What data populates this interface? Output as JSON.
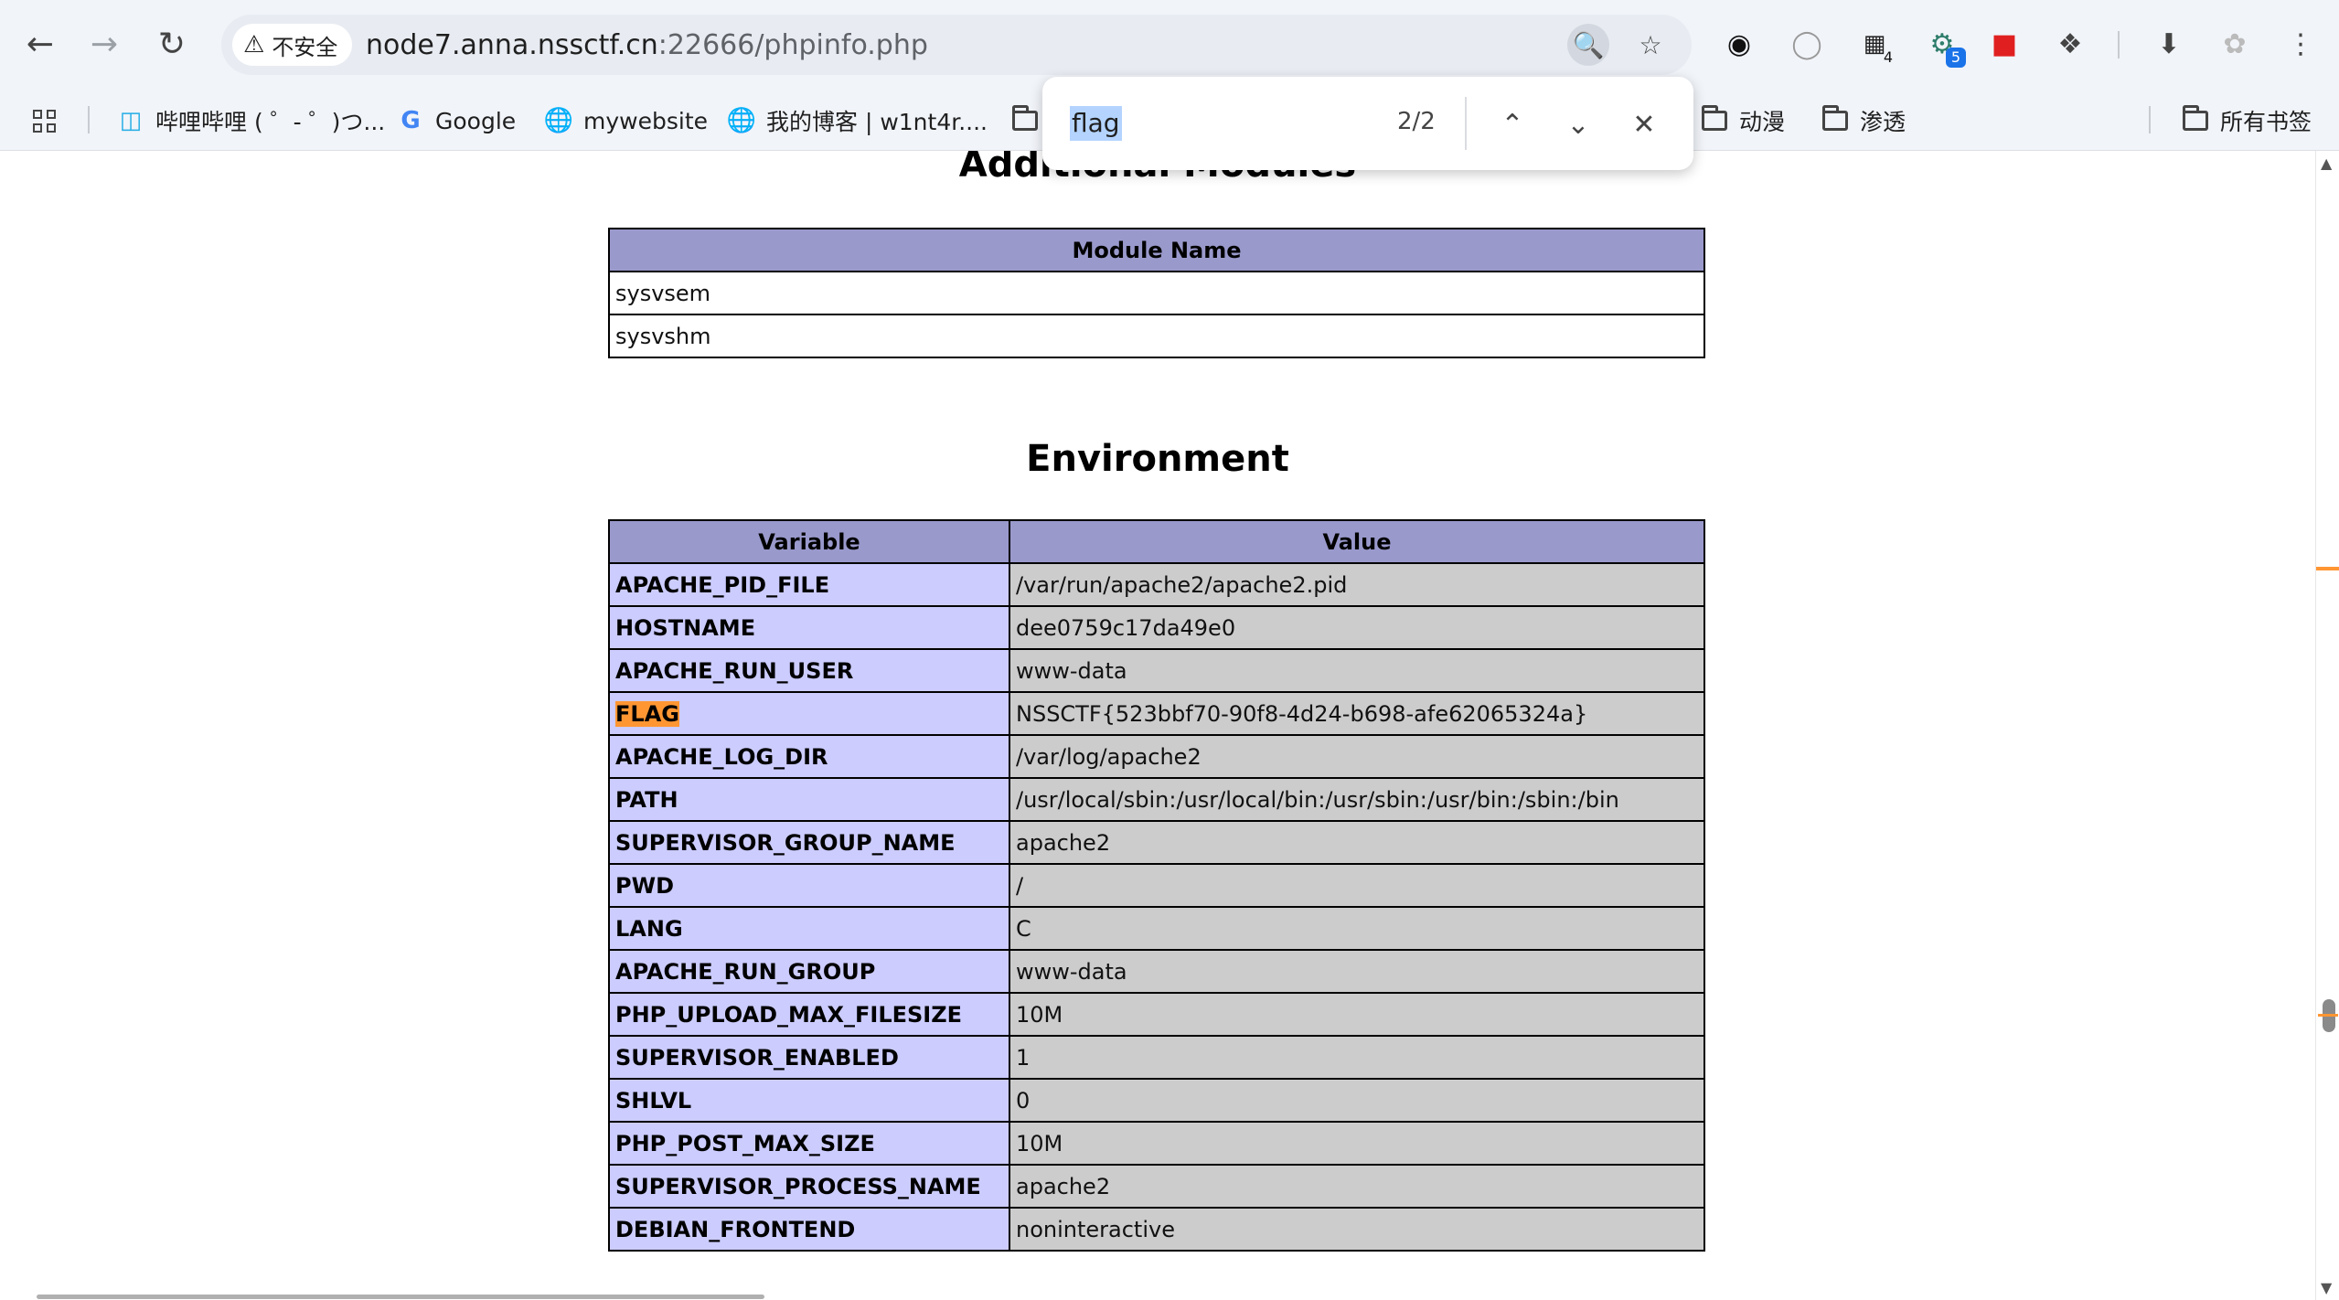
{
  "browser": {
    "security_label": "不安全",
    "url_host": "node7.anna.nssctf.cn",
    "url_rest": ":22666/phpinfo.php",
    "extension_badges": {
      "ext3": "4",
      "ext4": "5"
    }
  },
  "bookmarks": {
    "items": [
      {
        "label": "哔哩哔哩 ( ゜- ゜)つ...",
        "icon": "bilibili-icon"
      },
      {
        "label": "Google",
        "icon": "google-icon"
      },
      {
        "label": "mywebsite",
        "icon": "globe-icon"
      },
      {
        "label": "我的博客 | w1nt4r....",
        "icon": "globe-icon"
      },
      {
        "label": "动漫",
        "icon": "folder-icon"
      },
      {
        "label": "渗透",
        "icon": "folder-icon"
      }
    ],
    "all_bookmarks_label": "所有书签"
  },
  "find_bar": {
    "query": "flag",
    "count": "2/2"
  },
  "page": {
    "modules_heading": "Additional Modules",
    "modules_column": "Module Name",
    "modules": [
      "sysvsem",
      "sysvshm"
    ],
    "environment_heading": "Environment",
    "env_columns": {
      "variable": "Variable",
      "value": "Value"
    },
    "env_rows": [
      {
        "variable": "APACHE_PID_FILE",
        "value": "/var/run/apache2/apache2.pid"
      },
      {
        "variable": "HOSTNAME",
        "value": "dee0759c17da49e0"
      },
      {
        "variable": "APACHE_RUN_USER",
        "value": "www-data"
      },
      {
        "variable": "FLAG",
        "value": "NSSCTF{523bbf70-90f8-4d24-b698-afe62065324a}",
        "highlighted": true
      },
      {
        "variable": "APACHE_LOG_DIR",
        "value": "/var/log/apache2"
      },
      {
        "variable": "PATH",
        "value": "/usr/local/sbin:/usr/local/bin:/usr/sbin:/usr/bin:/sbin:/bin"
      },
      {
        "variable": "SUPERVISOR_GROUP_NAME",
        "value": "apache2"
      },
      {
        "variable": "PWD",
        "value": "/"
      },
      {
        "variable": "LANG",
        "value": "C"
      },
      {
        "variable": "APACHE_RUN_GROUP",
        "value": "www-data"
      },
      {
        "variable": "PHP_UPLOAD_MAX_FILESIZE",
        "value": "10M"
      },
      {
        "variable": "SUPERVISOR_ENABLED",
        "value": "1"
      },
      {
        "variable": "SHLVL",
        "value": "0"
      },
      {
        "variable": "PHP_POST_MAX_SIZE",
        "value": "10M"
      },
      {
        "variable": "SUPERVISOR_PROCESS_NAME",
        "value": "apache2"
      },
      {
        "variable": "DEBIAN_FRONTEND",
        "value": "noninteractive"
      }
    ]
  },
  "colors": {
    "find_highlight": "#ff9632",
    "php_header": "#9999cc",
    "php_key": "#ccccff",
    "php_value": "#cccccc"
  }
}
